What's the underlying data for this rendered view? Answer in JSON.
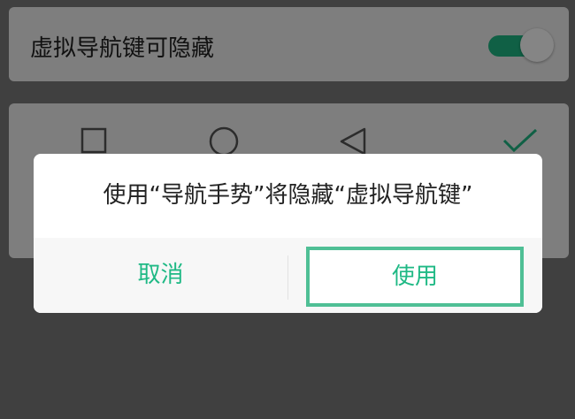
{
  "settings": {
    "hide_nav_keys_label": "虚拟导航键可隐藏",
    "hide_nav_keys_toggle_on": true,
    "nav_bar_icons": [
      "square-icon",
      "circle-icon",
      "back-triangle-icon",
      "checkmark-icon"
    ]
  },
  "dialog": {
    "message": "使用“导航手势”将隐藏“虚拟导航键”",
    "cancel_label": "取消",
    "confirm_label": "使用"
  },
  "colors": {
    "accent": "#1fb985",
    "scrim": "#7b7b7b",
    "dialog_bg": "#ffffff"
  }
}
